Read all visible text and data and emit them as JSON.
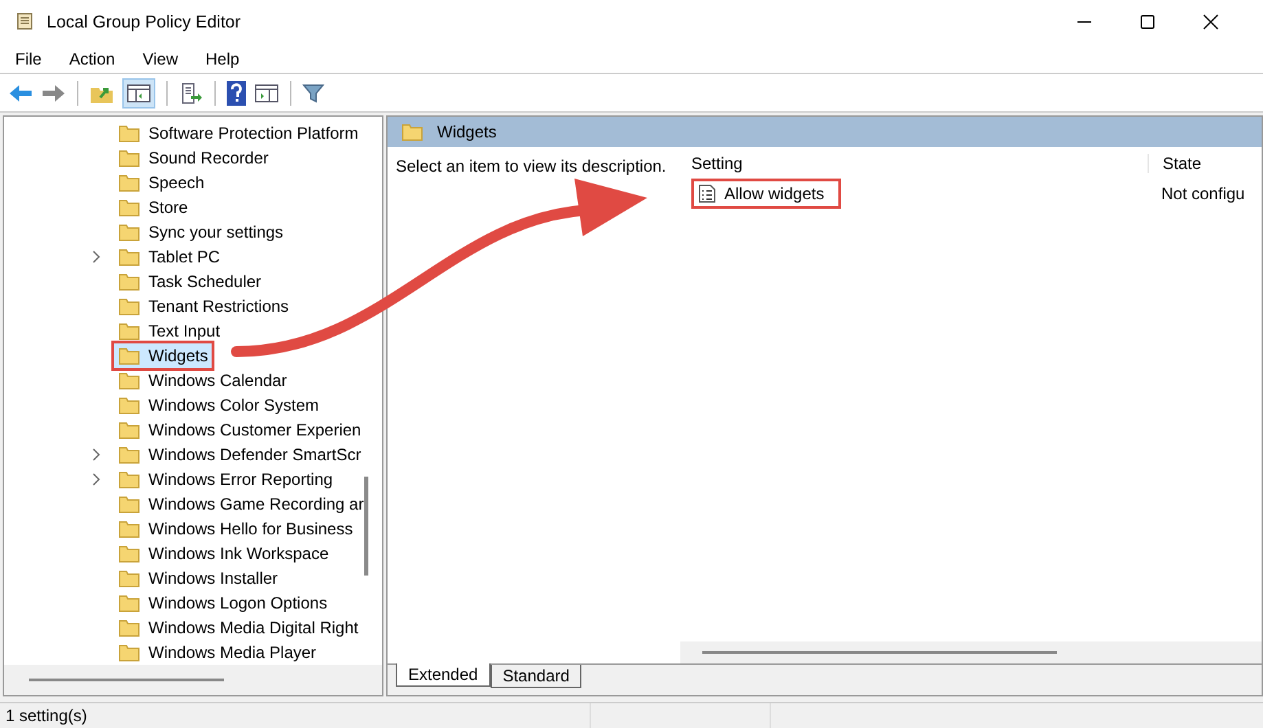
{
  "window": {
    "title": "Local Group Policy Editor"
  },
  "menu": [
    "File",
    "Action",
    "View",
    "Help"
  ],
  "tree": {
    "items": [
      {
        "label": "Software Protection Platform",
        "expandable": false,
        "selected": false,
        "highlighted": false
      },
      {
        "label": "Sound Recorder",
        "expandable": false,
        "selected": false,
        "highlighted": false
      },
      {
        "label": "Speech",
        "expandable": false,
        "selected": false,
        "highlighted": false
      },
      {
        "label": "Store",
        "expandable": false,
        "selected": false,
        "highlighted": false
      },
      {
        "label": "Sync your settings",
        "expandable": false,
        "selected": false,
        "highlighted": false
      },
      {
        "label": "Tablet PC",
        "expandable": true,
        "selected": false,
        "highlighted": false
      },
      {
        "label": "Task Scheduler",
        "expandable": false,
        "selected": false,
        "highlighted": false
      },
      {
        "label": "Tenant Restrictions",
        "expandable": false,
        "selected": false,
        "highlighted": false
      },
      {
        "label": "Text Input",
        "expandable": false,
        "selected": false,
        "highlighted": false
      },
      {
        "label": "Widgets",
        "expandable": false,
        "selected": true,
        "highlighted": true
      },
      {
        "label": "Windows Calendar",
        "expandable": false,
        "selected": false,
        "highlighted": false
      },
      {
        "label": "Windows Color System",
        "expandable": false,
        "selected": false,
        "highlighted": false
      },
      {
        "label": "Windows Customer Experien",
        "expandable": false,
        "selected": false,
        "highlighted": false
      },
      {
        "label": "Windows Defender SmartScr",
        "expandable": true,
        "selected": false,
        "highlighted": false
      },
      {
        "label": "Windows Error Reporting",
        "expandable": true,
        "selected": false,
        "highlighted": false
      },
      {
        "label": "Windows Game Recording ar",
        "expandable": false,
        "selected": false,
        "highlighted": false
      },
      {
        "label": "Windows Hello for Business",
        "expandable": false,
        "selected": false,
        "highlighted": false
      },
      {
        "label": "Windows Ink Workspace",
        "expandable": false,
        "selected": false,
        "highlighted": false
      },
      {
        "label": "Windows Installer",
        "expandable": false,
        "selected": false,
        "highlighted": false
      },
      {
        "label": "Windows Logon Options",
        "expandable": false,
        "selected": false,
        "highlighted": false
      },
      {
        "label": "Windows Media Digital Right",
        "expandable": false,
        "selected": false,
        "highlighted": false
      },
      {
        "label": "Windows Media Player",
        "expandable": false,
        "selected": false,
        "highlighted": false
      }
    ]
  },
  "details": {
    "header": "Widgets",
    "description": "Select an item to view its description.",
    "columns": [
      "Setting",
      "State"
    ],
    "rows": [
      {
        "setting": "Allow widgets",
        "state": "Not configu",
        "highlighted": true
      }
    ]
  },
  "tabs": [
    {
      "label": "Extended",
      "selected": true
    },
    {
      "label": "Standard",
      "selected": false
    }
  ],
  "status_bar": "1 setting(s)"
}
